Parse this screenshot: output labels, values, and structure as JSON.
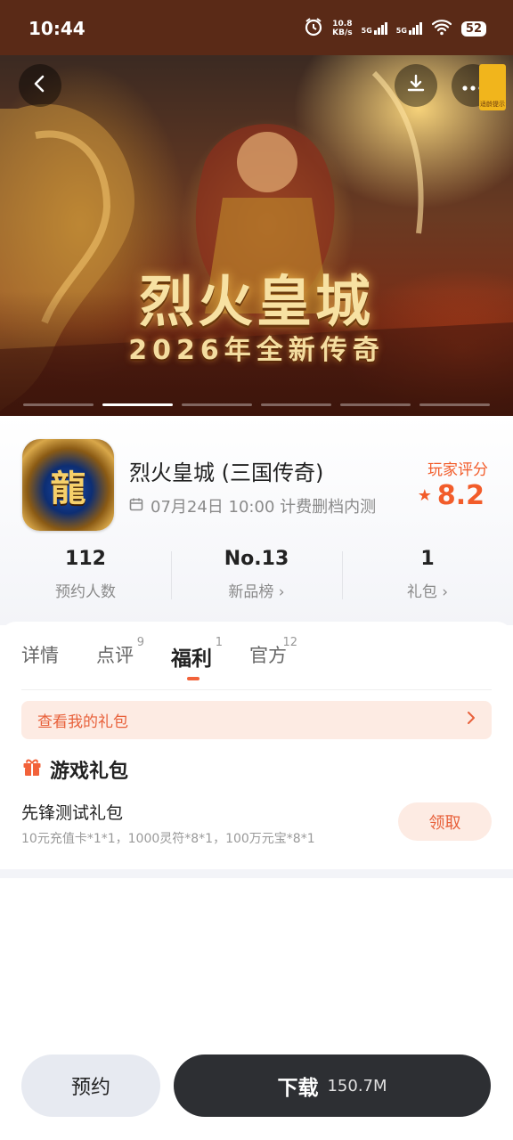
{
  "status_bar": {
    "time": "10:44",
    "net_speed_value": "10.8",
    "net_speed_unit": "KB/s",
    "sim1_label": "5G",
    "sim2_label": "5G",
    "battery": "52",
    "icons": [
      "alarm-icon",
      "signal-icon",
      "wifi-icon",
      "battery-icon"
    ]
  },
  "hero": {
    "title": "烈火皇城",
    "subtitle": "2026年全新传奇",
    "age_notice": "适龄提示",
    "carousel": {
      "pages": 6,
      "active_index": 1
    }
  },
  "game": {
    "icon_glyph": "龍",
    "name": "烈火皇城 (三国传奇)",
    "date_text": "07月24日 10:00 计费删档内测",
    "rating_label": "玩家评分",
    "rating_value": "8.2",
    "accent_color": "#f25c2a"
  },
  "stats": [
    {
      "value": "112",
      "label": "预约人数",
      "chevron": ""
    },
    {
      "value": "No.13",
      "label": "新品榜",
      "chevron": "›"
    },
    {
      "value": "1",
      "label": "礼包",
      "chevron": "›"
    }
  ],
  "tabs": [
    {
      "label": "详情",
      "count": ""
    },
    {
      "label": "点评",
      "count": "9"
    },
    {
      "label": "福利",
      "count": "1"
    },
    {
      "label": "官方",
      "count": "12"
    }
  ],
  "active_tab_index": 2,
  "welfare": {
    "my_gifts_link": "查看我的礼包",
    "section_title": "游戏礼包",
    "gift": {
      "name": "先锋测试礼包",
      "description": "10元充值卡*1*1，1000灵符*8*1，100万元宝*8*1",
      "claim_label": "领取"
    }
  },
  "bottom_bar": {
    "reserve_label": "预约",
    "download_label": "下载",
    "download_size": "150.7M"
  }
}
